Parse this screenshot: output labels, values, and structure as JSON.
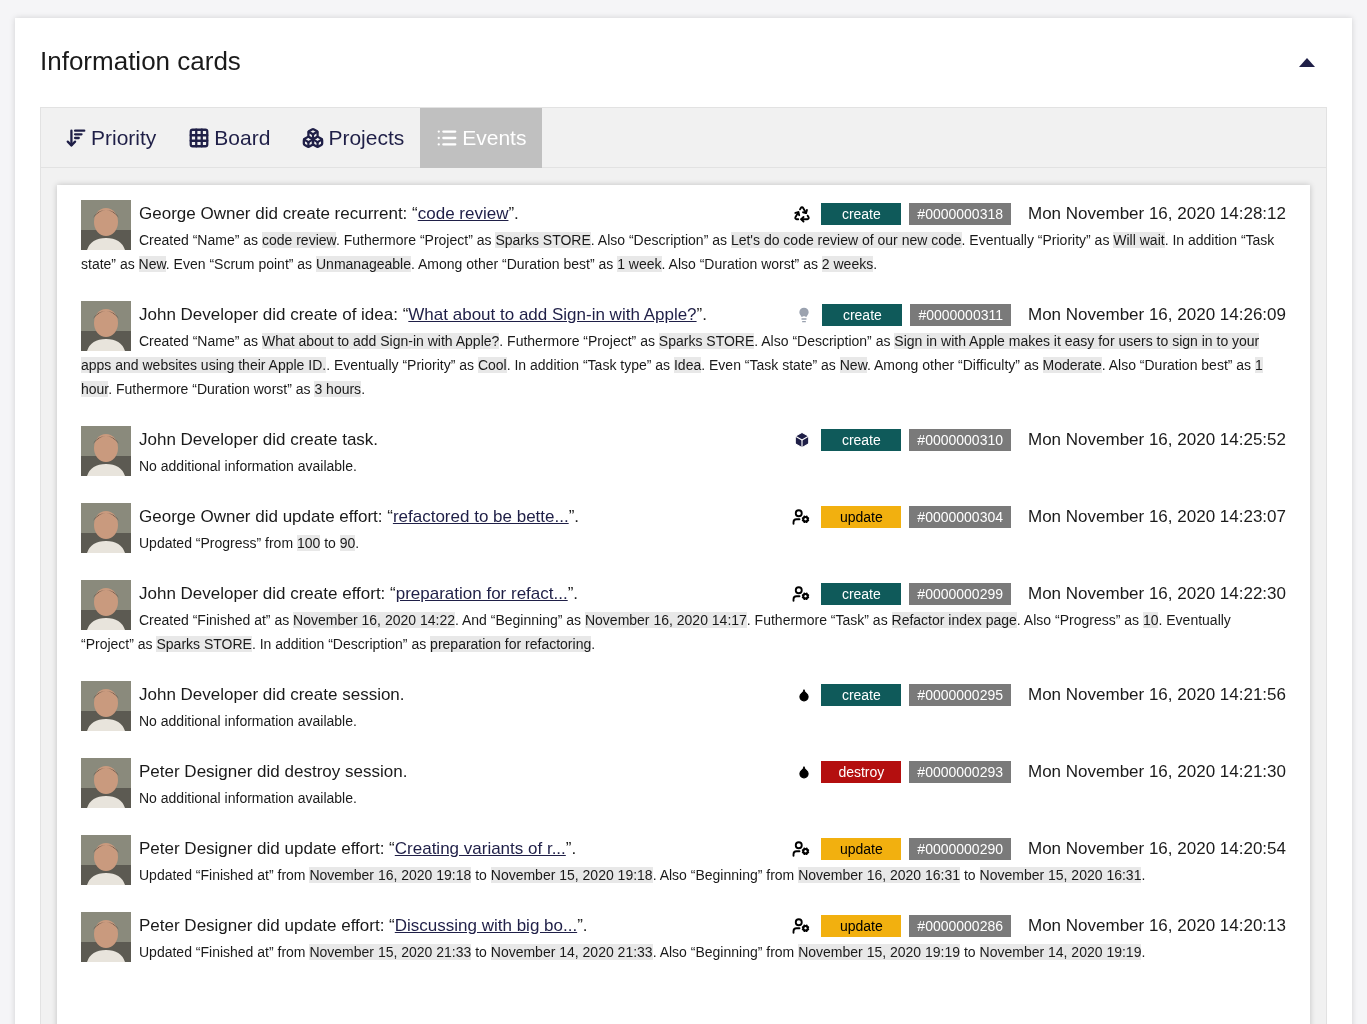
{
  "title": "Information cards",
  "collapse": {
    "expanded": true
  },
  "tabs": [
    {
      "label": "Priority",
      "selected": false
    },
    {
      "label": "Board",
      "selected": false
    },
    {
      "label": "Projects",
      "selected": false
    },
    {
      "label": "Events",
      "selected": true
    }
  ],
  "events": [
    {
      "title": "George Owner did create recurrent: “",
      "link": "code review",
      "title_end": "”.",
      "kind": "recurrent",
      "action": "create",
      "number": "#0000000318",
      "time": "Mon November 16, 2020 14:28:12",
      "description": [
        {
          "text": "Created “Name” as "
        },
        {
          "value": "code review"
        },
        {
          "text": ". Futhermore “Project” as "
        },
        {
          "value": "Sparks STORE"
        },
        {
          "text": ". Also “Description” as "
        },
        {
          "value": "Let's do code review of our new code"
        },
        {
          "text": ". Eventually “Priority” as "
        },
        {
          "value": "Will wait"
        },
        {
          "text": ". In addition “Task state” as "
        },
        {
          "value": "New"
        },
        {
          "text": ". Even “Scrum point” as "
        },
        {
          "value": "Unmanageable"
        },
        {
          "text": ". Among other “Duration best” as "
        },
        {
          "value": "1 week"
        },
        {
          "text": ". Also “Duration worst” as "
        },
        {
          "value": "2 weeks"
        },
        {
          "text": "."
        }
      ]
    },
    {
      "title": "John Developer did create of idea: “",
      "link": "What about to add Sign-in with Apple?",
      "title_end": "”.",
      "kind": "idea",
      "action": "create",
      "number": "#0000000311",
      "time": "Mon November 16, 2020 14:26:09",
      "description": [
        {
          "text": "Created “Name” as "
        },
        {
          "value": "What about to add Sign-in with Apple?"
        },
        {
          "text": ". Futhermore “Project” as "
        },
        {
          "value": "Sparks STORE"
        },
        {
          "text": ". Also “Description” as "
        },
        {
          "value": "Sign in with Apple makes it easy for users to sign in to your apps and websites using their Apple ID."
        },
        {
          "text": ". Eventually “Priority” as "
        },
        {
          "value": "Cool"
        },
        {
          "text": ". In addition “Task type” as "
        },
        {
          "value": "Idea"
        },
        {
          "text": ". Even “Task state” as "
        },
        {
          "value": "New"
        },
        {
          "text": ". Among other “Difficulty” as "
        },
        {
          "value": "Moderate"
        },
        {
          "text": ". Also “Duration best” as "
        },
        {
          "value": "1 hour"
        },
        {
          "text": ". Futhermore “Duration worst” as "
        },
        {
          "value": "3 hours"
        },
        {
          "text": "."
        }
      ]
    },
    {
      "title": "John Developer did create task.",
      "kind": "task",
      "action": "create",
      "number": "#0000000310",
      "time": "Mon November 16, 2020 14:25:52",
      "description": [
        {
          "text": "No additional information available."
        }
      ]
    },
    {
      "title": "George Owner did update effort: “",
      "link": "refactored to be bette...",
      "title_end": "”.",
      "kind": "effort",
      "action": "update",
      "number": "#0000000304",
      "time": "Mon November 16, 2020 14:23:07",
      "description": [
        {
          "text": "Updated “Progress” from "
        },
        {
          "value": "100"
        },
        {
          "text": " to "
        },
        {
          "value": "90"
        },
        {
          "text": "."
        }
      ]
    },
    {
      "title": "John Developer did create effort: “",
      "link": "preparation for refact...",
      "title_end": "”.",
      "kind": "effort",
      "action": "create",
      "number": "#0000000299",
      "time": "Mon November 16, 2020 14:22:30",
      "description": [
        {
          "text": "Created “Finished at” as "
        },
        {
          "value": "November 16, 2020 14:22"
        },
        {
          "text": ". And “Beginning” as "
        },
        {
          "value": "November 16, 2020 14:17"
        },
        {
          "text": ". Futhermore “Task” as "
        },
        {
          "value": "Refactor index page"
        },
        {
          "text": ". Also “Progress” as "
        },
        {
          "value": "10"
        },
        {
          "text": ". Eventually “Project” as "
        },
        {
          "value": "Sparks STORE"
        },
        {
          "text": ". In addition “Description” as "
        },
        {
          "value": "preparation for refactoring"
        },
        {
          "text": "."
        }
      ]
    },
    {
      "title": "John Developer did create session.",
      "kind": "session",
      "action": "create",
      "number": "#0000000295",
      "time": "Mon November 16, 2020 14:21:56",
      "description": [
        {
          "text": "No additional information available."
        }
      ]
    },
    {
      "title": "Peter Designer did destroy session.",
      "kind": "session",
      "action": "destroy",
      "number": "#0000000293",
      "time": "Mon November 16, 2020 14:21:30",
      "description": [
        {
          "text": "No additional information available."
        }
      ]
    },
    {
      "title": "Peter Designer did update effort: “",
      "link": "Creating variants of r...",
      "title_end": "”.",
      "kind": "effort",
      "action": "update",
      "number": "#0000000290",
      "time": "Mon November 16, 2020 14:20:54",
      "description": [
        {
          "text": "Updated “Finished at” from "
        },
        {
          "value": "November 16, 2020 19:18"
        },
        {
          "text": " to "
        },
        {
          "value": "November 15, 2020 19:18"
        },
        {
          "text": ". Also “Beginning” from "
        },
        {
          "value": "November 16, 2020 16:31"
        },
        {
          "text": " to "
        },
        {
          "value": "November 15, 2020 16:31"
        },
        {
          "text": "."
        }
      ]
    },
    {
      "title": "Peter Designer did update effort: “",
      "link": "Discussing with big bo...",
      "title_end": "”.",
      "kind": "effort",
      "action": "update",
      "number": "#0000000286",
      "time": "Mon November 16, 2020 14:20:13",
      "description": [
        {
          "text": "Updated “Finished at” from "
        },
        {
          "value": "November 15, 2020 21:33"
        },
        {
          "text": " to "
        },
        {
          "value": "November 14, 2020 21:33"
        },
        {
          "text": ". Also “Beginning” from "
        },
        {
          "value": "November 15, 2020 19:19"
        },
        {
          "text": " to "
        },
        {
          "value": "November 14, 2020 19:19"
        },
        {
          "text": "."
        }
      ]
    }
  ]
}
